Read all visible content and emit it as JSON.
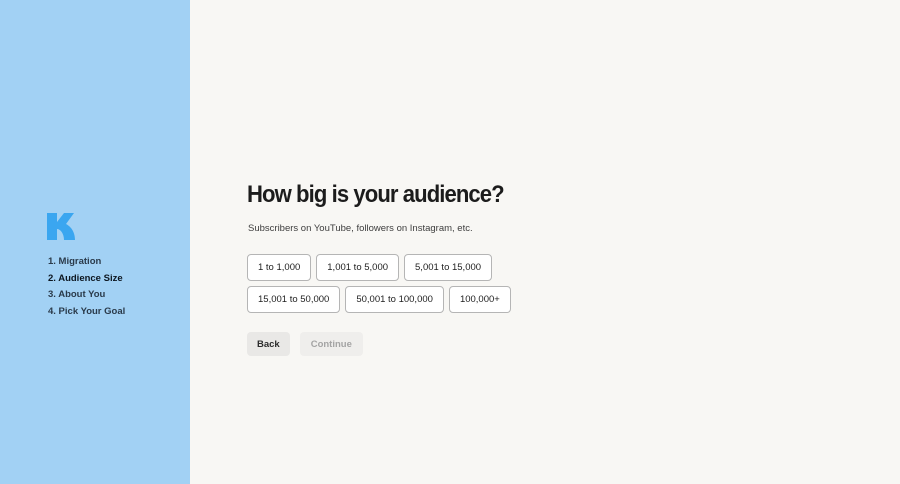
{
  "brand": {
    "logo_icon": "k-logo-icon",
    "logo_color": "#3aa6f0",
    "sidebar_color": "#a2d1f4"
  },
  "steps": [
    {
      "label": "1. Migration",
      "active": false
    },
    {
      "label": "2. Audience Size",
      "active": true
    },
    {
      "label": "3. About You",
      "active": false
    },
    {
      "label": "4. Pick Your Goal",
      "active": false
    }
  ],
  "question": {
    "title": "How big is your audience?",
    "subtitle": "Subscribers on YouTube, followers on Instagram, etc."
  },
  "options": [
    {
      "label": "1 to 1,000"
    },
    {
      "label": "1,001 to 5,000"
    },
    {
      "label": "5,001 to 15,000"
    },
    {
      "label": "15,001 to 50,000"
    },
    {
      "label": "50,001 to 100,000"
    },
    {
      "label": "100,000+"
    }
  ],
  "actions": {
    "back_label": "Back",
    "continue_label": "Continue"
  }
}
